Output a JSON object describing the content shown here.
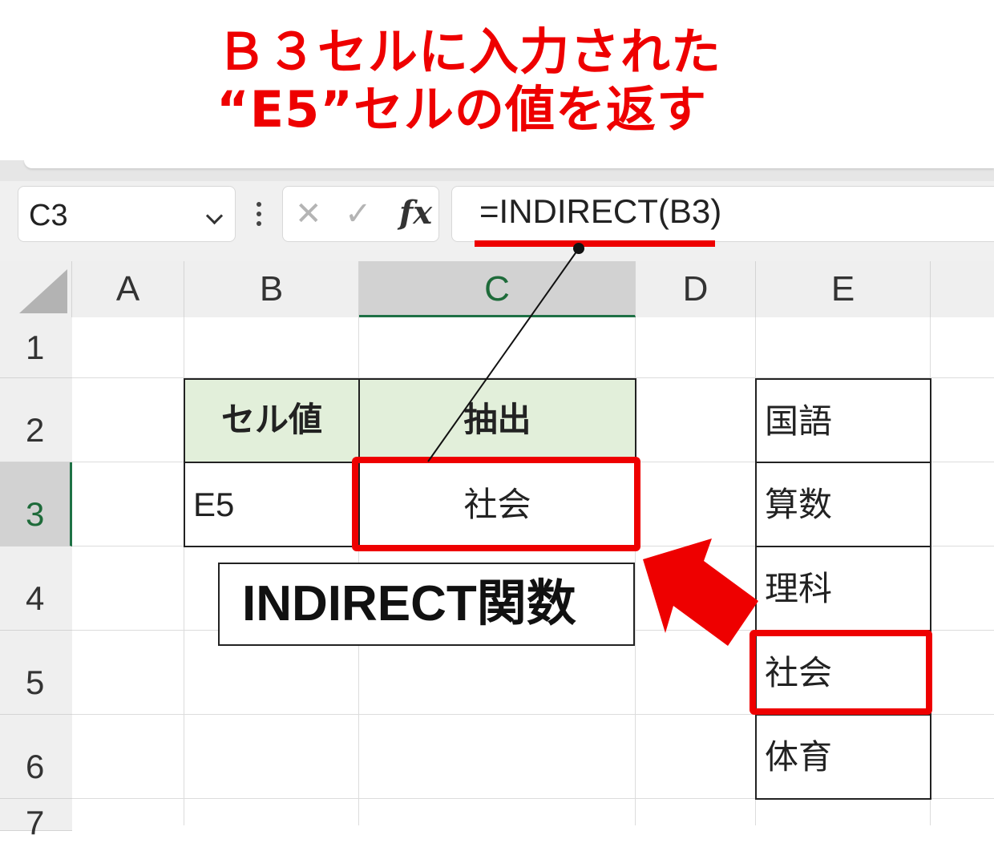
{
  "annotation": {
    "title_line1": "Ｂ３セルに入力された",
    "title_line2": "“E5”セルの値を返す",
    "label": "INDIRECT関数",
    "accent_color": "#ee0000"
  },
  "formula_bar": {
    "name_box": "C3",
    "cancel_icon": "✕",
    "enter_icon": "✓",
    "fx_label": "fx",
    "formula": "=INDIRECT(B3)"
  },
  "columns": [
    "A",
    "B",
    "C",
    "D",
    "E"
  ],
  "rows": [
    "1",
    "2",
    "3",
    "4",
    "5",
    "6",
    "7"
  ],
  "cells": {
    "B2": "セル値",
    "C2": "抽出",
    "B3": "E5",
    "C3": "社会",
    "E2": "国語",
    "E3": "算数",
    "E4": "理科",
    "E5": "社会",
    "E6": "体育"
  },
  "selected_cell": "C3"
}
